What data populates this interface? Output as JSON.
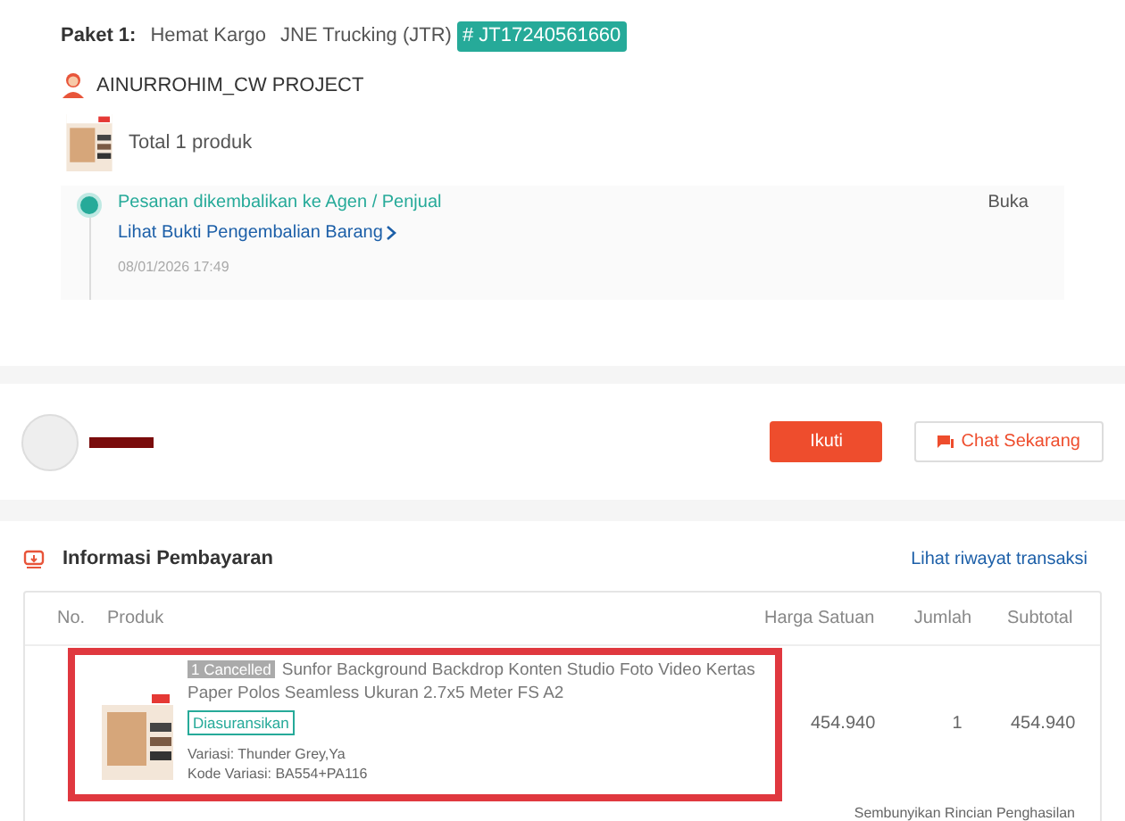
{
  "package": {
    "label": "Paket 1:",
    "service": "Hemat Kargo",
    "courier": "JNE Trucking (JTR)",
    "tracking": "# JT17240561660"
  },
  "shop": {
    "name": "AINURROHIM_CW PROJECT"
  },
  "product_summary": "Total 1 produk",
  "timeline": {
    "status": "Pesanan dikembalikan ke Agen / Penjual",
    "link": "Lihat Bukti Pengembalian Barang",
    "time": "08/01/2026 17:49",
    "action": "Buka"
  },
  "seller": {
    "buttons": [
      {
        "label": "Ikuti",
        "kind": "primary"
      },
      {
        "label": "Chat Sekarang",
        "kind": "chat"
      }
    ]
  },
  "payment": {
    "title": "Informasi Pembayaran",
    "link": "Lihat riwayat transaksi",
    "table": {
      "columns": [
        "No.",
        "Produk",
        "Harga Satuan",
        "Jumlah",
        "Subtotal"
      ],
      "rows": [
        {
          "badge": "1 Cancelled",
          "name": "Sunfor Background Backdrop Konten Studio Foto Video Kertas Paper Polos Seamless Ukuran 2.7x5 Meter FS A2",
          "tag": "Diasuransikan",
          "variant": "Variasi: Thunder Grey,Ya",
          "variant_code": "Kode Variasi: BA554+PA116",
          "price": "454.940",
          "qty": "1",
          "subtotal": "454.940",
          "highlighted": true
        }
      ]
    },
    "footer_link": "Sembunyikan Rincian Penghasilan"
  }
}
